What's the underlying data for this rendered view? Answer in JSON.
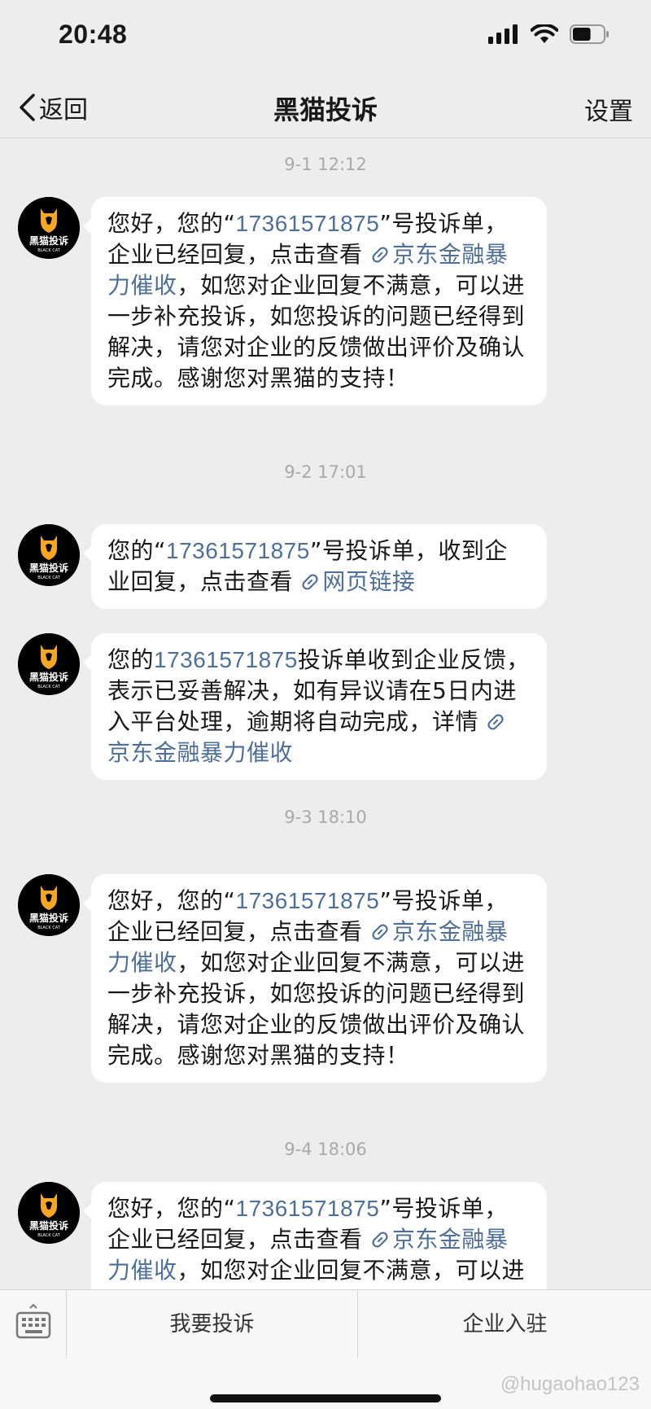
{
  "status_bar": {
    "time": "20:48",
    "battery_level": 0.6
  },
  "nav": {
    "back_label": "返回",
    "title": "黑猫投诉",
    "settings_label": "设置"
  },
  "avatar": {
    "brand_text": "黑猫投诉",
    "brand_sub": "BLACK CAT",
    "color": "#f5a623"
  },
  "chat": {
    "ts1": "9-1 12:12",
    "m1": {
      "prefix": "您好，您的“",
      "number": "17361571875",
      "mid": "”号投诉单，企业已经回复，点击查看 ",
      "link": "京东金融暴力催收",
      "suffix": "，如您对企业回复不满意，可以进一步补充投诉，如您投诉的问题已经得到解决，请您对企业的反馈做出评价及确认完成。感谢您对黑猫的支持！"
    },
    "ts2": "9-2 17:01",
    "m2": {
      "prefix": "您的“",
      "number": "17361571875",
      "mid": "”号投诉单，收到企业回复，点击查看 ",
      "link": "网页链接"
    },
    "m3": {
      "prefix": "您的",
      "number": "17361571875",
      "mid": "投诉单收到企业反馈，表示已妥善解决，如有异议请在5日内进入平台处理，逾期将自动完成，详情 ",
      "link": "京东金融暴力催收"
    },
    "ts3": "9-3 18:10",
    "m4": {
      "prefix": "您好，您的“",
      "number": "17361571875",
      "mid": "”号投诉单，企业已经回复，点击查看 ",
      "link": "京东金融暴力催收",
      "suffix": "，如您对企业回复不满意，可以进一步补充投诉，如您投诉的问题已经得到解决，请您对企业的反馈做出评价及确认完成。感谢您对黑猫的支持！"
    },
    "ts4": "9-4 18:06",
    "m5": {
      "prefix": "您好，您的“",
      "number": "17361571875",
      "mid": "”号投诉单，企业已经回复，点击查看 ",
      "link": "京东金融暴力催收",
      "suffix": "，如您对企业回复不满意，可以进一步补充投诉，如您投诉的问题已经得到解决，请您对企业的反馈做出评价及确认完成。感谢您对黑猫的支持！"
    }
  },
  "bottom": {
    "complain_label": "我要投诉",
    "join_label": "企业入驻",
    "watermark": "@hugaohao123"
  },
  "colors": {
    "link": "#4e6f9a",
    "background": "#ededed",
    "bubble": "#ffffff"
  }
}
